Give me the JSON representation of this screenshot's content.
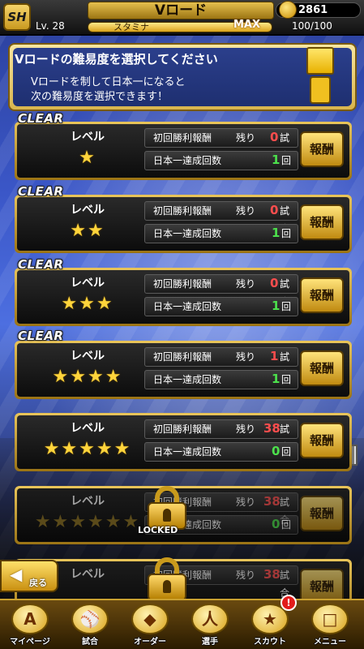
{
  "header": {
    "logo": "SH",
    "title": "Vロード",
    "level_prefix": "Lv.",
    "level": "28",
    "stamina_label": "スタミナ",
    "stamina_max": "MAX",
    "stamina_value": "100/100",
    "coins": "2861",
    "coin_icon": "coin-icon"
  },
  "info": {
    "title": "Vロードの難易度を選択してください",
    "line1": "Vロードを制して日本一になると",
    "line2": "次の難易度を選択できます！"
  },
  "levels": [
    {
      "clear": "CLEAR",
      "label": "レベル",
      "stars": "★",
      "row1_label": "初回勝利報酬",
      "remain": "残り",
      "remain_num": "0",
      "remain_unit": "試合",
      "row2_label": "日本一達成回数",
      "count": "1",
      "count_unit": "回",
      "reward": "報酬"
    },
    {
      "clear": "CLEAR",
      "label": "レベル",
      "stars": "★★",
      "row1_label": "初回勝利報酬",
      "remain": "残り",
      "remain_num": "0",
      "remain_unit": "試合",
      "row2_label": "日本一達成回数",
      "count": "1",
      "count_unit": "回",
      "reward": "報酬"
    },
    {
      "clear": "CLEAR",
      "label": "レベル",
      "stars": "★★★",
      "row1_label": "初回勝利報酬",
      "remain": "残り",
      "remain_num": "0",
      "remain_unit": "試合",
      "row2_label": "日本一達成回数",
      "count": "1",
      "count_unit": "回",
      "reward": "報酬"
    },
    {
      "clear": "CLEAR",
      "label": "レベル",
      "stars": "★★★★",
      "row1_label": "初回勝利報酬",
      "remain": "残り",
      "remain_num": "1",
      "remain_unit": "試合",
      "row2_label": "日本一達成回数",
      "count": "1",
      "count_unit": "回",
      "reward": "報酬"
    },
    {
      "clear": "",
      "label": "レベル",
      "stars": "★★★★★",
      "row1_label": "初回勝利報酬",
      "remain": "残り",
      "remain_num": "38",
      "remain_unit": "試合",
      "row2_label": "日本一達成回数",
      "count": "0",
      "count_unit": "回",
      "reward": "報酬"
    },
    {
      "clear": "",
      "label": "レベル",
      "stars": "★★★★★★",
      "row1_label": "初回勝利報酬",
      "remain": "残り",
      "remain_num": "38",
      "remain_unit": "試合",
      "row2_label": "日本一達成回数",
      "count": "0",
      "count_unit": "回",
      "reward": "報酬",
      "locked_text": "LOCKED"
    },
    {
      "clear": "",
      "label": "レベル",
      "stars": "",
      "row1_label": "初回勝利報酬",
      "remain": "残り",
      "remain_num": "38",
      "remain_unit": "試合",
      "row2_label": "",
      "count": "",
      "count_unit": "",
      "reward": "報酬"
    }
  ],
  "back": {
    "label": "戻る"
  },
  "nav": {
    "items": [
      {
        "label": "マイページ",
        "icon": "A"
      },
      {
        "label": "試合",
        "icon": "⚾"
      },
      {
        "label": "オーダー",
        "icon": "◆"
      },
      {
        "label": "選手",
        "icon": "人"
      },
      {
        "label": "スカウト",
        "icon": "★"
      },
      {
        "label": "メニュー",
        "icon": "□"
      }
    ],
    "scout_badge": "!"
  }
}
